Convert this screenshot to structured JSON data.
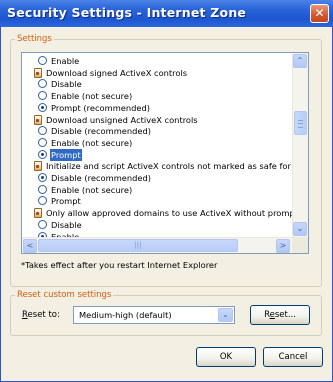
{
  "window": {
    "title": "Security Settings - Internet Zone",
    "close_glyph": "✕"
  },
  "settings": {
    "legend": "Settings",
    "list": [
      {
        "kind": "option",
        "label": "Enable",
        "checked": false,
        "selected": false
      },
      {
        "kind": "group",
        "label": "Download signed ActiveX controls",
        "icon": "settings-icon"
      },
      {
        "kind": "option",
        "label": "Disable",
        "checked": false,
        "selected": false
      },
      {
        "kind": "option",
        "label": "Enable (not secure)",
        "checked": false,
        "selected": false
      },
      {
        "kind": "option",
        "label": "Prompt (recommended)",
        "checked": true,
        "selected": false
      },
      {
        "kind": "group",
        "label": "Download unsigned ActiveX controls",
        "icon": "settings-icon"
      },
      {
        "kind": "option",
        "label": "Disable (recommended)",
        "checked": false,
        "selected": false
      },
      {
        "kind": "option",
        "label": "Enable (not secure)",
        "checked": false,
        "selected": false
      },
      {
        "kind": "option",
        "label": "Prompt",
        "checked": true,
        "selected": true
      },
      {
        "kind": "group",
        "label": "Initialize and script ActiveX controls not marked as safe for sc",
        "icon": "settings-icon"
      },
      {
        "kind": "option",
        "label": "Disable (recommended)",
        "checked": true,
        "selected": false
      },
      {
        "kind": "option",
        "label": "Enable (not secure)",
        "checked": false,
        "selected": false
      },
      {
        "kind": "option",
        "label": "Prompt",
        "checked": false,
        "selected": false
      },
      {
        "kind": "group",
        "label": "Only allow approved domains to use ActiveX without prompt",
        "icon": "settings-icon"
      },
      {
        "kind": "option",
        "label": "Disable",
        "checked": false,
        "selected": false
      },
      {
        "kind": "option",
        "label": "Enable",
        "checked": true,
        "selected": false
      }
    ],
    "scroll_up_glyph": "⌃",
    "scroll_down_glyph": "⌄",
    "scroll_left_glyph": "<",
    "scroll_right_glyph": ">",
    "h_thumb_glyph": "|||",
    "note": "*Takes effect after you restart Internet Explorer"
  },
  "reset": {
    "legend": "Reset custom settings",
    "label_prefix": "R",
    "label_rest": "eset to:",
    "value": "Medium-high (default)",
    "dropdown_glyph": "⌄",
    "button_prefix": "R",
    "button_u": "e",
    "button_rest": "set..."
  },
  "buttons": {
    "ok": "OK",
    "cancel": "Cancel"
  },
  "colors": {
    "titlebar": "#2a64d9",
    "legend": "#d35c0e",
    "selection": "#316ac5",
    "dialog_bg": "#f3f0e3"
  }
}
